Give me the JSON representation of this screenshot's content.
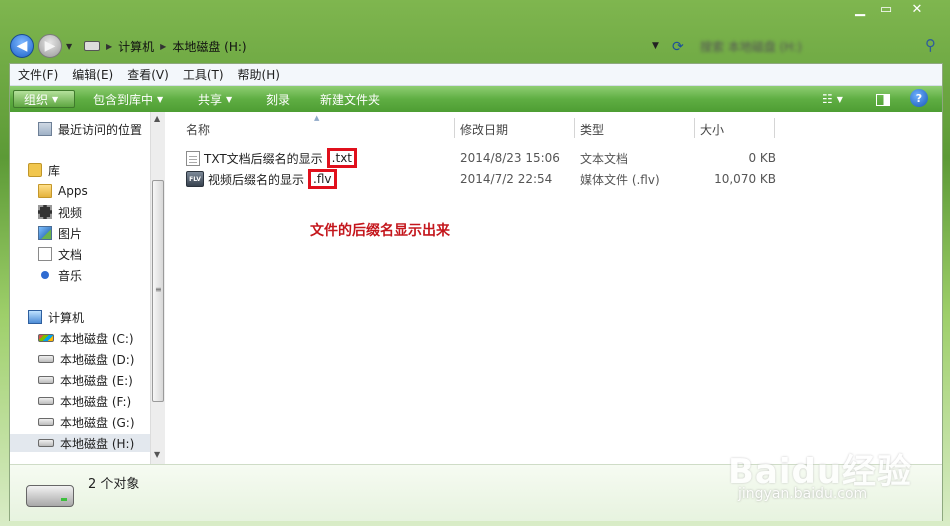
{
  "window": {
    "controls": {
      "minimize": "▁",
      "maximize": "▭",
      "close": "✕"
    }
  },
  "address": {
    "path": [
      "计算机",
      "本地磁盘 (H:)"
    ],
    "search_placeholder": "搜索 本地磁盘 (H:)"
  },
  "menu": [
    "文件(F)",
    "编辑(E)",
    "查看(V)",
    "工具(T)",
    "帮助(H)"
  ],
  "toolbar": {
    "organize": "组织",
    "include_in_library": "包含到库中",
    "share": "共享",
    "burn": "刻录",
    "new_folder": "新建文件夹"
  },
  "sidebar": {
    "recent": "最近访问的位置",
    "libraries": "库",
    "library_items": [
      "Apps",
      "视频",
      "图片",
      "文档",
      "音乐"
    ],
    "computer": "计算机",
    "drives": [
      "本地磁盘 (C:)",
      "本地磁盘 (D:)",
      "本地磁盘 (E:)",
      "本地磁盘 (F:)",
      "本地磁盘 (G:)",
      "本地磁盘 (H:)"
    ],
    "selected_index": 5
  },
  "columns": {
    "name": "名称",
    "date": "修改日期",
    "type": "类型",
    "size": "大小"
  },
  "files": [
    {
      "name": "TXT文档后缀名的显示",
      "ext": ".txt",
      "date": "2014/8/23 15:06",
      "type": "文本文档",
      "size": "0 KB",
      "icon": "text-document-icon"
    },
    {
      "name": "视频后缀名的显示",
      "ext": ".flv",
      "date": "2014/7/2 22:54",
      "type": "媒体文件 (.flv)",
      "size": "10,070 KB",
      "icon": "flv-video-icon"
    }
  ],
  "flv_icon_label": "FLV",
  "annotation": "文件的后缀名显示出来",
  "status": {
    "count": "2 个对象"
  },
  "watermark": {
    "logo": "Baidu经验",
    "url": "jingyan.baidu.com"
  }
}
